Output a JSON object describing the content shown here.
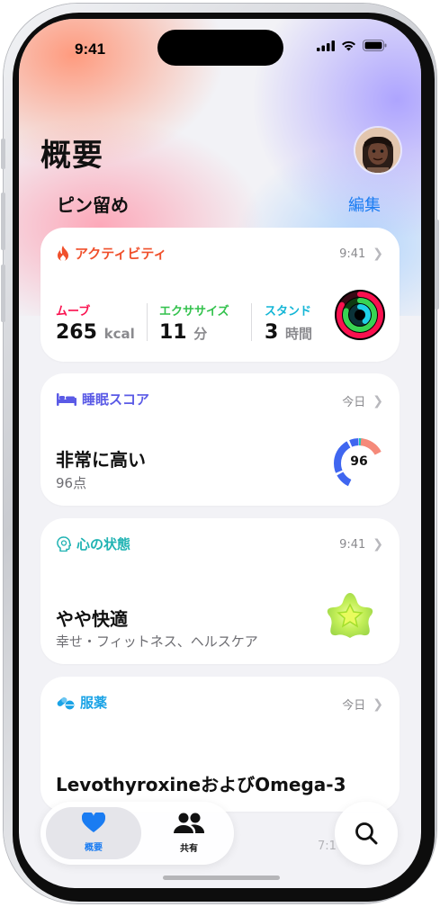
{
  "status_bar": {
    "time": "9:41"
  },
  "header": {
    "title": "概要"
  },
  "pinned": {
    "title": "ピン留め",
    "edit_label": "編集"
  },
  "activity": {
    "title": "アクティビティ",
    "time": "9:41",
    "move": {
      "label": "ムーブ",
      "value": "265",
      "unit": "kcal"
    },
    "exercise": {
      "label": "エクササイズ",
      "value": "11",
      "unit": "分"
    },
    "stand": {
      "label": "スタンド",
      "value": "3",
      "unit": "時間"
    },
    "colors": {
      "move": "#fa114f",
      "exercise": "#39d353",
      "stand": "#1fd1e8",
      "accent": "#f0502c"
    }
  },
  "sleep": {
    "title": "睡眠スコア",
    "date": "今日",
    "headline": "非常に高い",
    "points": "96点",
    "score": "96",
    "accent": "#5a5ae6"
  },
  "mind": {
    "title": "心の状態",
    "time": "9:41",
    "headline": "やや快適",
    "detail": "幸せ・フィットネス、ヘルスケア",
    "accent": "#20b3b3"
  },
  "medication": {
    "title": "服薬",
    "date": "今日",
    "headline": "LevothyroxineおよびOmega-3",
    "accent": "#1aa3e6"
  },
  "tabbar": {
    "summary_label": "概要",
    "sharing_label": "共有"
  },
  "peek_time": "7:1"
}
